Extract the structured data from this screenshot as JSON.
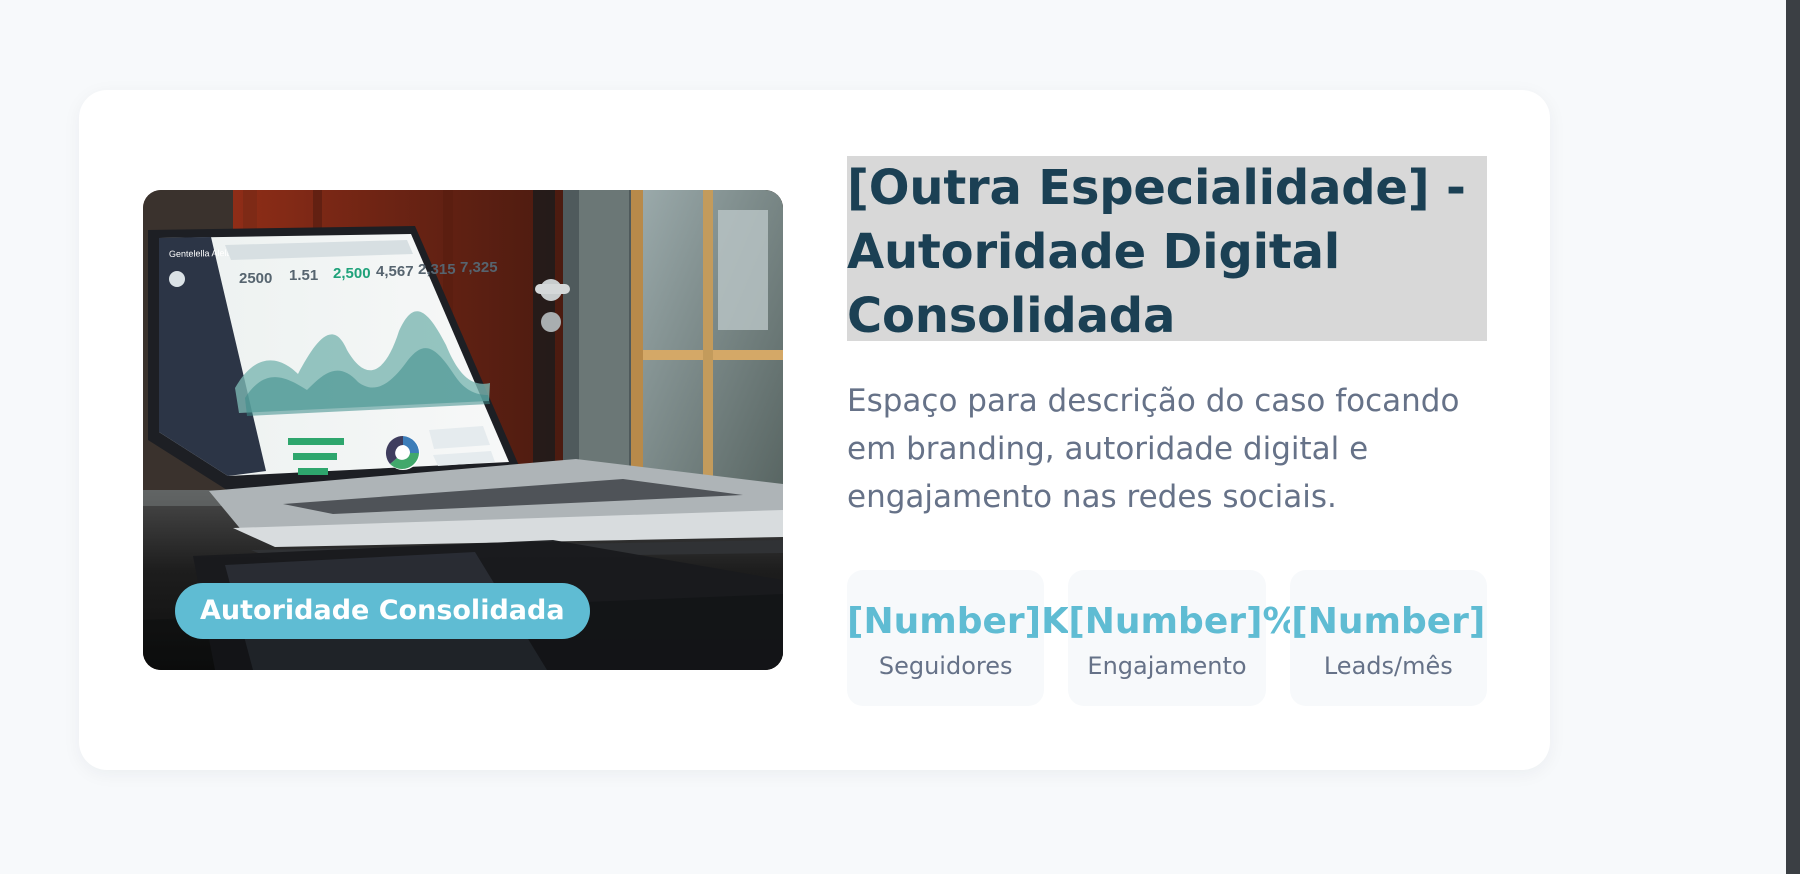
{
  "case_card": {
    "image": {
      "description_icon": "laptop-dashboard-photo",
      "badge": "Autoridade Consolidada"
    },
    "title": "[Outra Especialidade] - Autoridade Digital Consolidada",
    "description": "Espaço para descrição do caso focando em branding, autoridade digital e engajamento nas redes sociais.",
    "stats": [
      {
        "value": "[Number]K",
        "label": "Seguidores"
      },
      {
        "value": "[Number]%",
        "label": "Engajamento"
      },
      {
        "value": "[Number]",
        "label": "Leads/mês"
      }
    ],
    "laptop_screen": {
      "brand": "Gentelella Alela!",
      "kpis": [
        "2500",
        "1.51",
        "2,500",
        "4,567",
        "2,315",
        "7,325"
      ]
    }
  },
  "colors": {
    "page_background": "#f7f9fb",
    "card_background": "#ffffff",
    "title_color": "#1b4054",
    "title_highlight": "#d8d8d8",
    "accent": "#5fbcd3",
    "muted_text": "#667288",
    "stat_background": "#f7f9fb",
    "right_edge": "#3b3f44"
  }
}
